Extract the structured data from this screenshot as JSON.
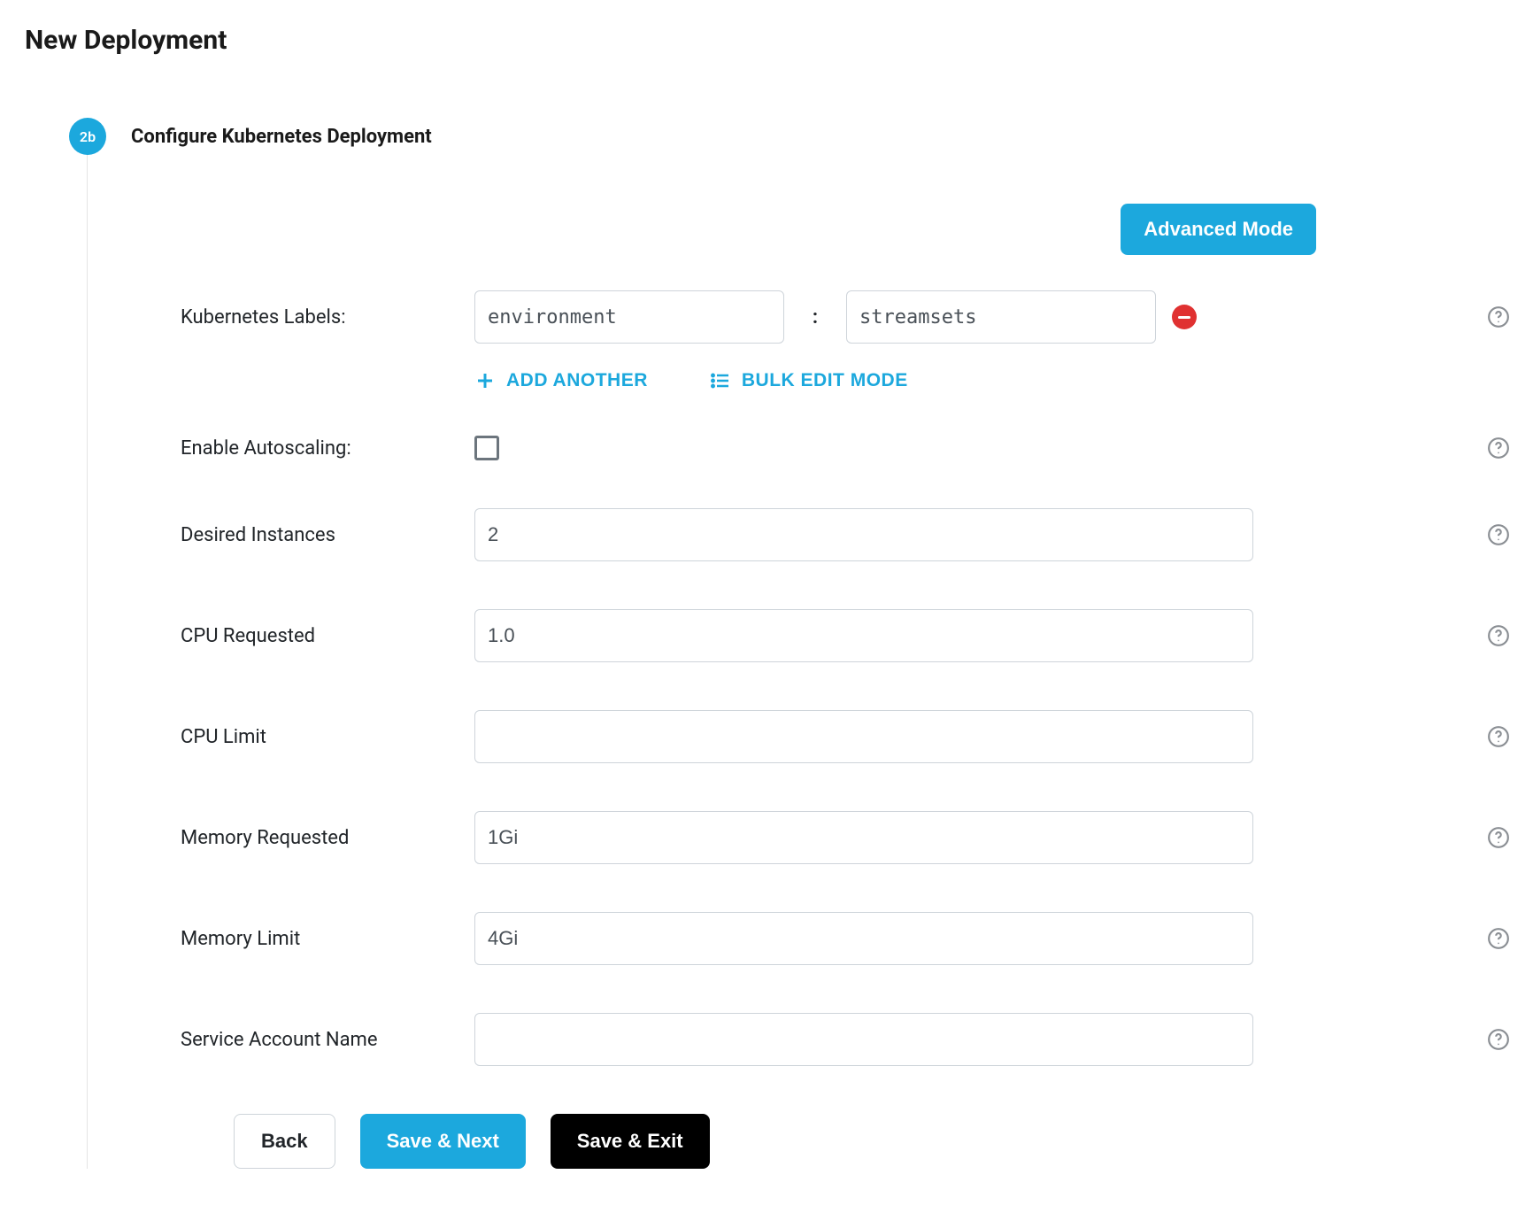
{
  "header": {
    "title": "New Deployment"
  },
  "step": {
    "badge": "2b",
    "title": "Configure Kubernetes Deployment"
  },
  "advanced_button": "Advanced Mode",
  "labels": {
    "kubernetes_labels": "Kubernetes Labels:",
    "enable_autoscaling": "Enable Autoscaling:",
    "desired_instances": "Desired Instances",
    "cpu_requested": "CPU Requested",
    "cpu_limit": "CPU Limit",
    "memory_requested": "Memory Requested",
    "memory_limit": "Memory Limit",
    "service_account_name": "Service Account Name"
  },
  "values": {
    "label_key": "environment",
    "label_value": "streamsets",
    "desired_instances": "2",
    "cpu_requested": "1.0",
    "cpu_limit": "",
    "memory_requested": "1Gi",
    "memory_limit": "4Gi",
    "service_account_name": "",
    "enable_autoscaling": false
  },
  "actions": {
    "add_another": "ADD ANOTHER",
    "bulk_edit": "BULK EDIT MODE",
    "back": "Back",
    "save_next": "Save & Next",
    "save_exit": "Save & Exit"
  }
}
